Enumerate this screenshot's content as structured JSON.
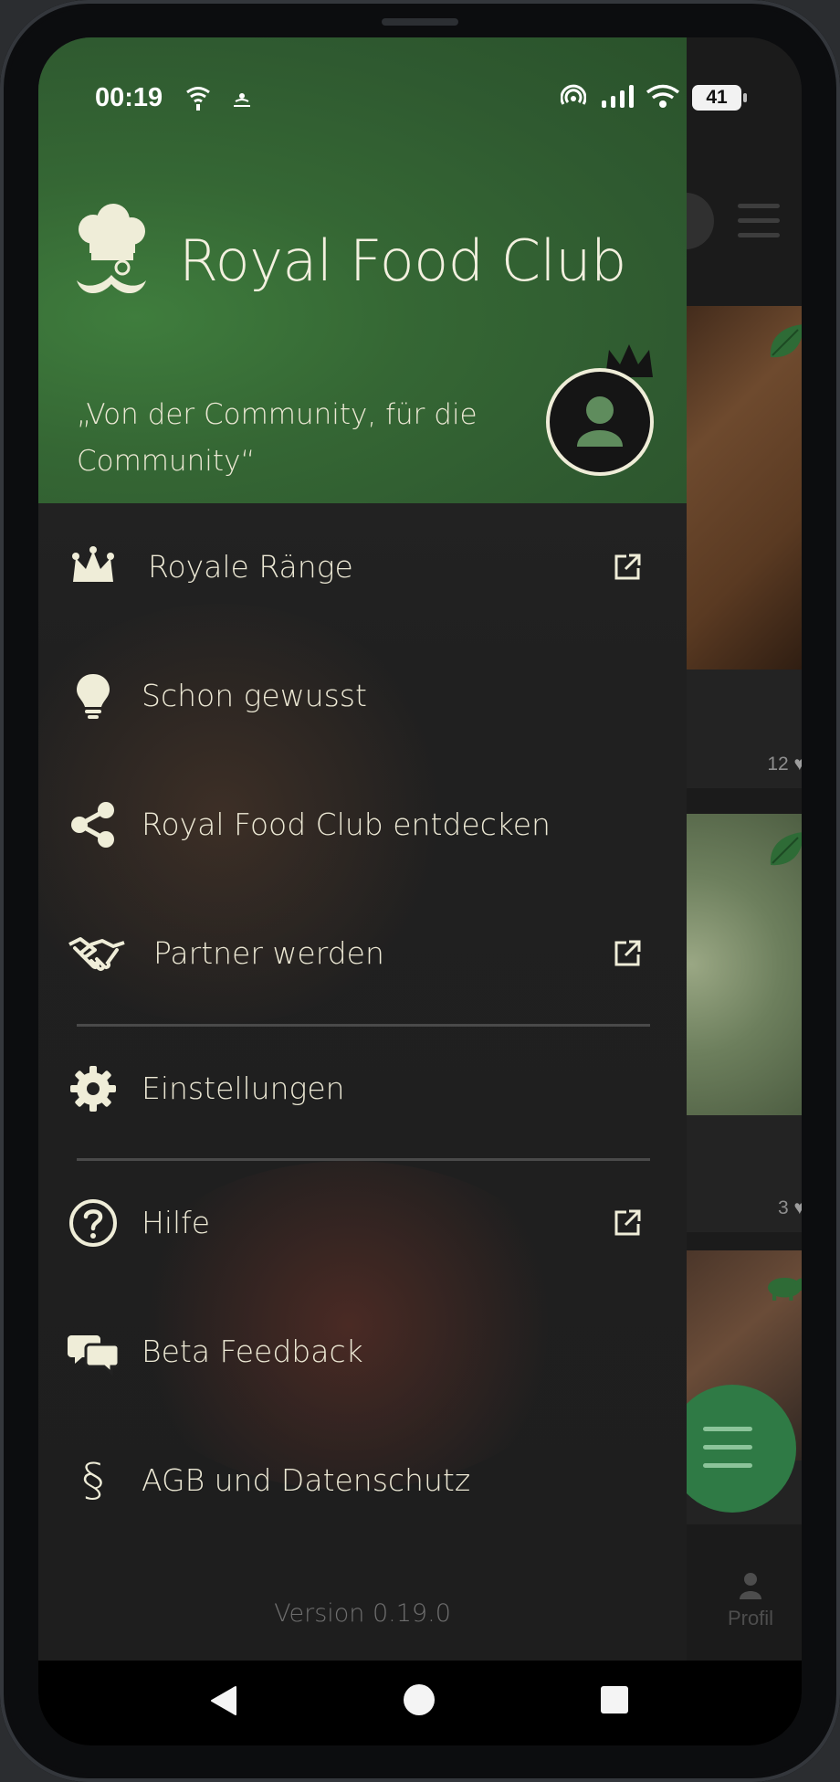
{
  "status_bar": {
    "time": "00:19",
    "battery": "41"
  },
  "drawer": {
    "app_title": "Royal Food Club",
    "tagline": "„Von der Community, für die Community“",
    "menu": [
      {
        "label": "Royale Ränge",
        "icon": "crown-icon",
        "external": true
      },
      {
        "label": "Schon gewusst",
        "icon": "lightbulb-icon",
        "external": false
      },
      {
        "label": "Royal Food Club entdecken",
        "icon": "share-icon",
        "external": false
      },
      {
        "label": "Partner werden",
        "icon": "handshake-icon",
        "external": true
      },
      {
        "label": "Einstellungen",
        "icon": "gear-icon",
        "external": false
      },
      {
        "label": "Hilfe",
        "icon": "help-circle-icon",
        "external": true
      },
      {
        "label": "Beta Feedback",
        "icon": "chat-bubbles-icon",
        "external": false
      },
      {
        "label": "AGB und Datenschutz",
        "icon": "paragraph-icon",
        "external": false
      }
    ],
    "version": "Version 0.19.0"
  },
  "background": {
    "card_likes": [
      "12",
      "3"
    ],
    "nav_profile_label": "Profil"
  },
  "colors": {
    "header_green": "#356734",
    "text_cream": "#ece8d4",
    "fab_green": "#2f7a45"
  }
}
